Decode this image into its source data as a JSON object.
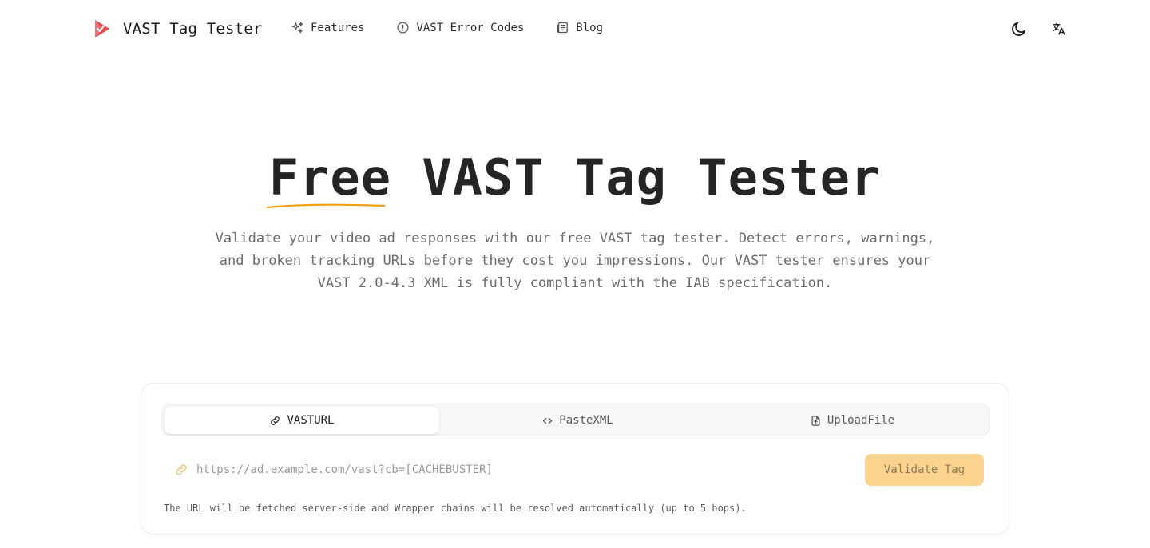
{
  "brand": {
    "name": "VAST Tag Tester",
    "accent": "#ef4444"
  },
  "nav": {
    "links": [
      {
        "label": "Features",
        "icon": "sparkles-icon"
      },
      {
        "label": "VAST Error Codes",
        "icon": "alert-circle-icon"
      },
      {
        "label": "Blog",
        "icon": "newspaper-icon"
      }
    ],
    "theme_toggle_icon": "moon-icon",
    "language_icon": "translate-icon"
  },
  "hero": {
    "title_highlight": "Free",
    "title_rest": " VAST Tag Tester",
    "underline_color": "#f59e0b",
    "description": "Validate your video ad responses with our free VAST tag tester. Detect errors, warnings, and broken tracking URLs before they cost you impressions. Our VAST tester ensures your VAST 2.0-4.3 XML is fully compliant with the IAB specification."
  },
  "tester": {
    "tabs": [
      {
        "label": "VASTURL",
        "icon": "link-icon",
        "active": true
      },
      {
        "label": "PasteXML",
        "icon": "code-icon",
        "active": false
      },
      {
        "label": "UploadFile",
        "icon": "file-upload-icon",
        "active": false
      }
    ],
    "url_input": {
      "value": "",
      "placeholder": "https://ad.example.com/vast?cb=[CACHEBUSTER]"
    },
    "validate_label": "Validate Tag",
    "button_color": "#fbd38d",
    "hint": "The URL will be fetched server-side and Wrapper chains will be resolved automatically (up to 5 hops)."
  }
}
